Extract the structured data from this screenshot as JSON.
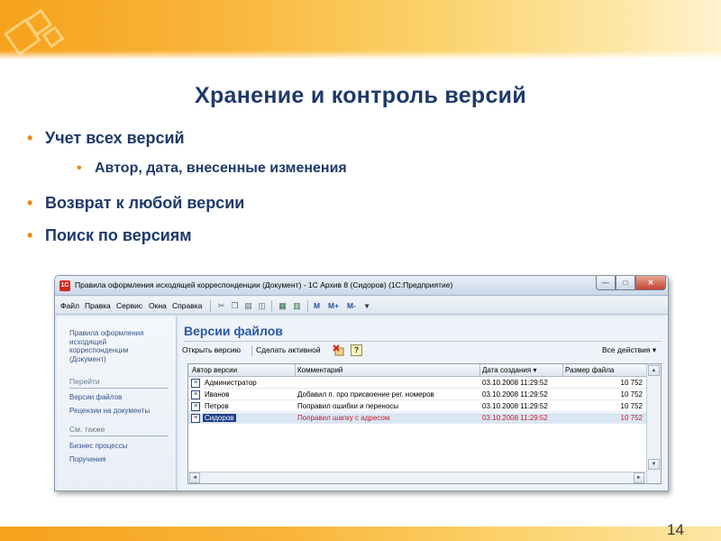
{
  "slide": {
    "title": "Хранение и контроль версий",
    "bullets": [
      "Учет всех версий",
      "Автор, дата, внесенные изменения",
      "Возврат к любой версии",
      "Поиск по версиям"
    ],
    "bullet_marker": "•",
    "page_number": "14",
    "colors": {
      "title": "#1f3a6b",
      "bullet_marker": "#e88a12",
      "banner": "#f6a21c"
    }
  },
  "window": {
    "logo": "1С",
    "title": "Правила оформления исходящей корреспонденции (Документ) - 1С Архив 8 (Сидоров) (1С:Предприятие)",
    "controls": {
      "minimize": "—",
      "maximize": "□",
      "close": "✕"
    },
    "menu": [
      "Файл",
      "Правка",
      "Сервис",
      "Окна",
      "Справка"
    ],
    "toolbar_icons": [
      "cut-icon",
      "copy-icon",
      "paste-icon",
      "paste-special-icon",
      "calculator-icon",
      "calendar-icon"
    ],
    "toolbar_text": [
      "M",
      "M+",
      "M-"
    ],
    "toolbar_dropdown": "▾"
  },
  "nav": {
    "document_link": "Правила оформления исходящей корреспонденции (Документ)",
    "goto_header": "Перейти",
    "goto_items": [
      "Версии файлов",
      "Рецензии на документы"
    ],
    "see_also_header": "См. также",
    "see_also_items": [
      "Бизнес процессы",
      "Поручения"
    ]
  },
  "content": {
    "title": "Версии файлов",
    "actions": [
      "Открыть версию",
      "Сделать активной"
    ],
    "help": "?",
    "all_actions": "Все действия ▾",
    "columns": [
      "Автор версии",
      "Комментарий",
      "Дата создания ▾",
      "Размер файла"
    ],
    "rows": [
      {
        "author": "Администратор",
        "comment": "",
        "date": "03.10.2008 11:29:52",
        "size": "10 752"
      },
      {
        "author": "Иванов",
        "comment": "Добавил п. про присвоение рег. номеров",
        "date": "03.10.2008 11:29:52",
        "size": "10 752"
      },
      {
        "author": "Петров",
        "comment": "Поправил ошибки и переносы",
        "date": "03.10.2008 11:29:52",
        "size": "10 752"
      },
      {
        "author": "Сидоров",
        "comment": "Поправил шапку с адресом",
        "date": "03.10.2008 11:29:52",
        "size": "10 752"
      }
    ],
    "selected_row": 3,
    "selected_color": "#cc2020",
    "scroll": {
      "up": "▲",
      "down": "▼",
      "left": "◄",
      "right": "►"
    }
  }
}
